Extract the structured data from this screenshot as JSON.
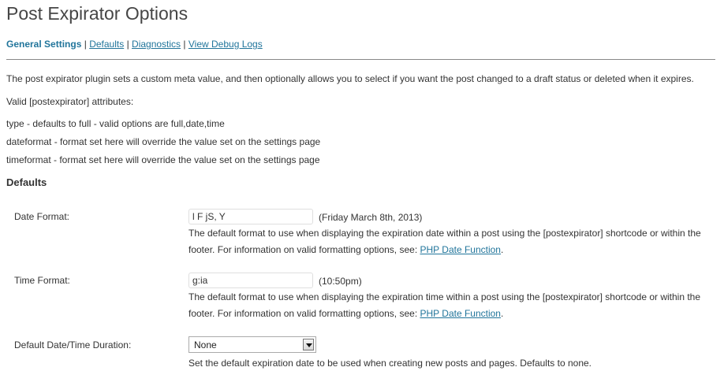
{
  "page": {
    "title": "Post Expirator Options"
  },
  "subnav": {
    "current": "General Settings",
    "separator": "|",
    "links": [
      "Defaults",
      "Diagnostics",
      "View Debug Logs"
    ]
  },
  "intro": {
    "description": "The post expirator plugin sets a custom meta value, and then optionally allows you to select if you want the post changed to a draft status or deleted when it expires.",
    "attributes_heading": "Valid [postexpirator] attributes:",
    "attributes": [
      "type - defaults to full - valid options are full,date,time",
      "dateformat - format set here will override the value set on the settings page",
      "timeformat - format set here will override the value set on the settings page"
    ]
  },
  "defaults": {
    "heading": "Defaults",
    "date_format": {
      "label": "Date Format:",
      "value": "l F jS, Y",
      "example": "(Friday March 8th, 2013)",
      "description": "The default format to use when displaying the expiration date within a post using the [postexpirator] shortcode or within the footer. For information on valid formatting options, see: ",
      "link": "PHP Date Function",
      "period": "."
    },
    "time_format": {
      "label": "Time Format:",
      "value": "g:ia",
      "example": "(10:50pm)",
      "description": "The default format to use when displaying the expiration time within a post using the [postexpirator] shortcode or within the footer. For information on valid formatting options, see: ",
      "link": "PHP Date Function",
      "period": "."
    },
    "duration": {
      "label": "Default Date/Time Duration:",
      "selected": "None",
      "description": "Set the default expiration date to be used when creating new posts and pages. Defaults to none."
    }
  },
  "colors": {
    "link": "#21759b",
    "text": "#333333",
    "heading": "#464646"
  },
  "icons": {
    "select_arrow": "chevron-down-icon"
  }
}
